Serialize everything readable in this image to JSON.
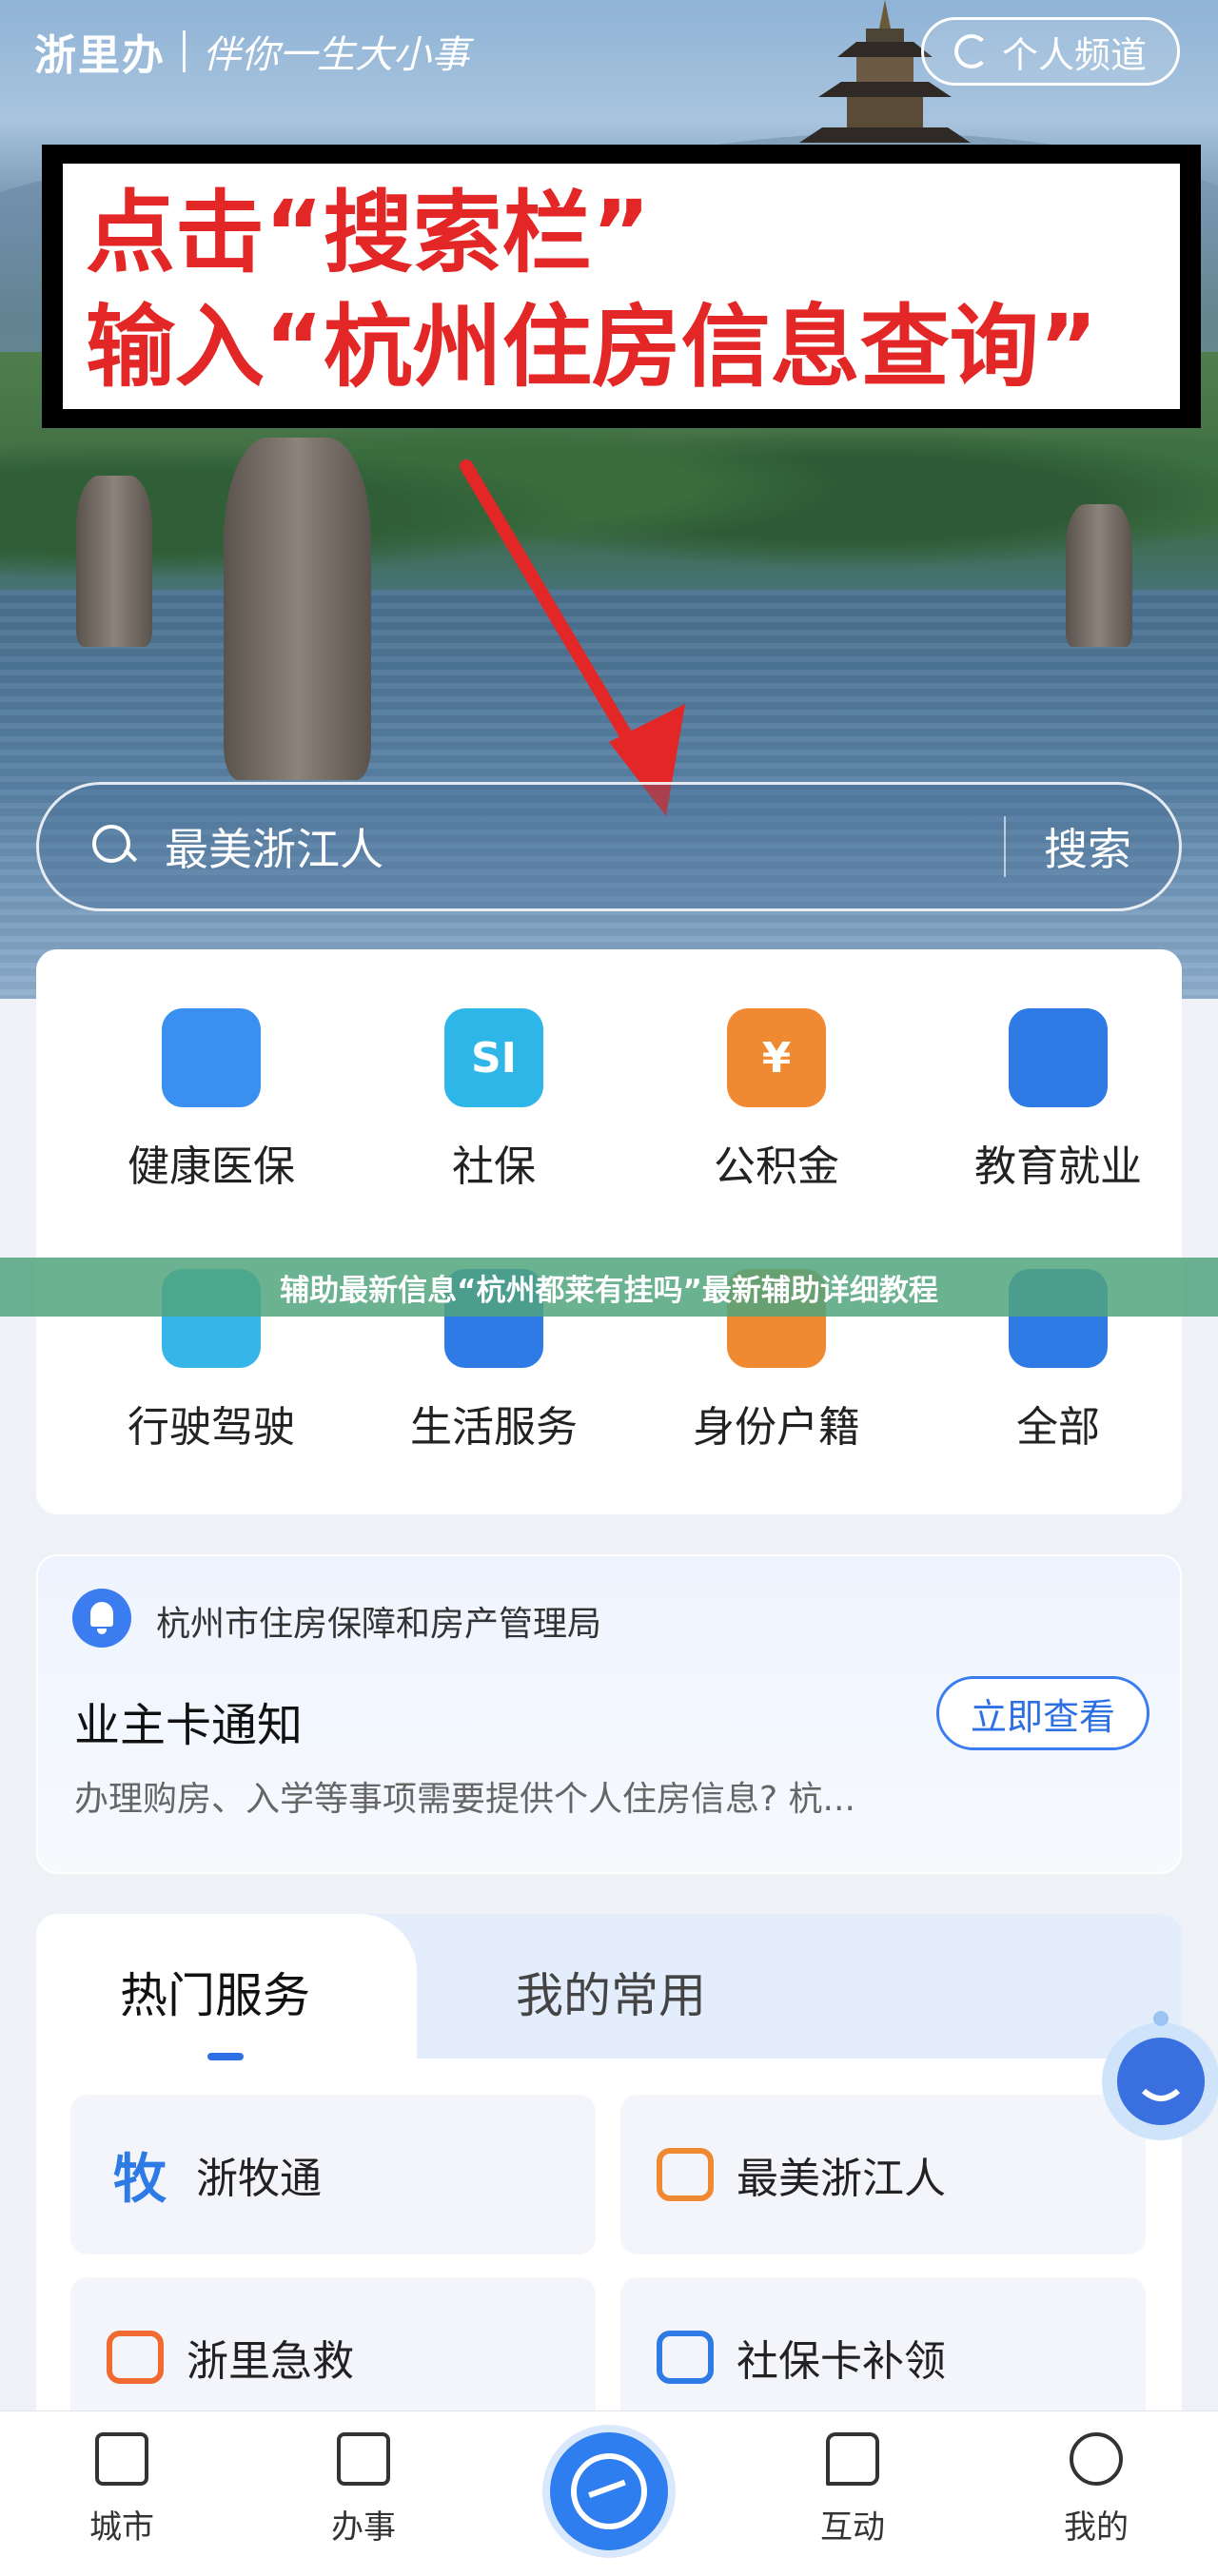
{
  "header": {
    "brand_name": "浙里办",
    "slogan": "伴你一生大小事",
    "channel_button": "个人频道"
  },
  "callout": {
    "line1": "点击“搜索栏”",
    "line2": "输入“杭州住房信息查询”"
  },
  "search": {
    "placeholder": "最美浙江人",
    "button": "搜索"
  },
  "services": [
    {
      "label": "健康医保",
      "icon": "medical-kit-icon",
      "color": "#3a8ff0"
    },
    {
      "label": "社保",
      "icon": "si-shield-icon",
      "color": "#2fb6e8",
      "icon_text": "SI"
    },
    {
      "label": "公积金",
      "icon": "yen-house-icon",
      "color": "#f08a32",
      "icon_text": "¥"
    },
    {
      "label": "教育就业",
      "icon": "graduation-cap-icon",
      "color": "#2f7be6"
    },
    {
      "label": "行驶驾驶",
      "icon": "car-icon",
      "color": "#36b5e8"
    },
    {
      "label": "生活服务",
      "icon": "lightning-icon",
      "color": "#2f7be6"
    },
    {
      "label": "身份户籍",
      "icon": "id-person-icon",
      "color": "#f08a32"
    },
    {
      "label": "全部",
      "icon": "grid-all-icon",
      "color": "#2f7be6"
    }
  ],
  "banner": {
    "text": "辅助最新信息“杭州都莱有挂吗”最新辅助详细教程"
  },
  "notice": {
    "org": "杭州市住房保障和房产管理局",
    "title": "业主卡通知",
    "description": "办理购房、入学等事项需要提供个人住房信息? 杭...",
    "view_button": "立即查看"
  },
  "hot_services": {
    "tabs": [
      {
        "label": "热门服务",
        "active": true
      },
      {
        "label": "我的常用",
        "active": false
      }
    ],
    "items": [
      {
        "label": "浙牧通",
        "icon": "mu-character-icon",
        "icon_text": "牧",
        "color": "#2f7be6"
      },
      {
        "label": "最美浙江人",
        "icon": "people-award-icon",
        "color": "#f08a32"
      },
      {
        "label": "浙里急救",
        "icon": "ambulance-icon",
        "color": "#f06a32"
      },
      {
        "label": "社保卡补领",
        "icon": "shield-person-icon",
        "color": "#2f7be6"
      }
    ]
  },
  "bottom_nav": [
    {
      "label": "城市",
      "icon": "city-building-icon"
    },
    {
      "label": "办事",
      "icon": "document-icon"
    },
    {
      "label": "",
      "icon": "zheliban-logo-icon"
    },
    {
      "label": "互动",
      "icon": "chat-icon"
    },
    {
      "label": "我的",
      "icon": "person-icon"
    }
  ]
}
